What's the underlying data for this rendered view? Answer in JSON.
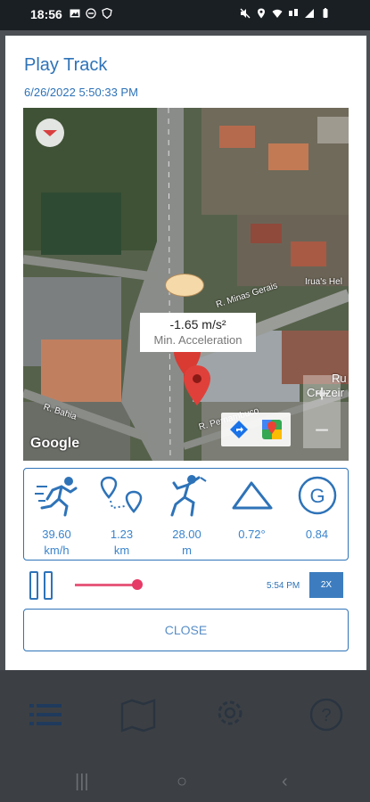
{
  "statusbar": {
    "time": "18:56",
    "left_icons": [
      "image-icon",
      "do-not-disturb-icon",
      "vpn-shield-icon"
    ],
    "right_icons": [
      "mute-icon",
      "location-icon",
      "wifi-icon",
      "mobile-data-icon",
      "signal-icon",
      "battery-icon"
    ]
  },
  "dialog": {
    "title": "Play Track",
    "date": "6/26/2022 5:50:33 PM"
  },
  "map": {
    "tooltip_value": "-1.65 m/s²",
    "tooltip_label": "Min. Acceleration",
    "google": "Google",
    "streets": [
      "R. Bahia",
      "R. Pernambuco",
      "R. Minas Gerais",
      "Irua's Hel",
      "Ru",
      "Cruzeir"
    ],
    "zoom_in": "+",
    "zoom_out": "−"
  },
  "stats": [
    {
      "icon": "runner-speed-icon",
      "value": "39.60",
      "unit": "km/h"
    },
    {
      "icon": "distance-route-icon",
      "value": "1.23",
      "unit": "km"
    },
    {
      "icon": "climber-altitude-icon",
      "value": "28.00",
      "unit": "m"
    },
    {
      "icon": "slope-angle-icon",
      "value": "0.72°",
      "unit": ""
    },
    {
      "icon": "g-force-icon",
      "value": "0.84",
      "unit": ""
    }
  ],
  "player": {
    "progress": 0.35,
    "time": "5:54 PM",
    "speed": "2X"
  },
  "close_label": "CLOSE",
  "colors": {
    "accent": "#2e73b8",
    "slider": "#e63b66",
    "speed_button": "#3d7dbf"
  }
}
